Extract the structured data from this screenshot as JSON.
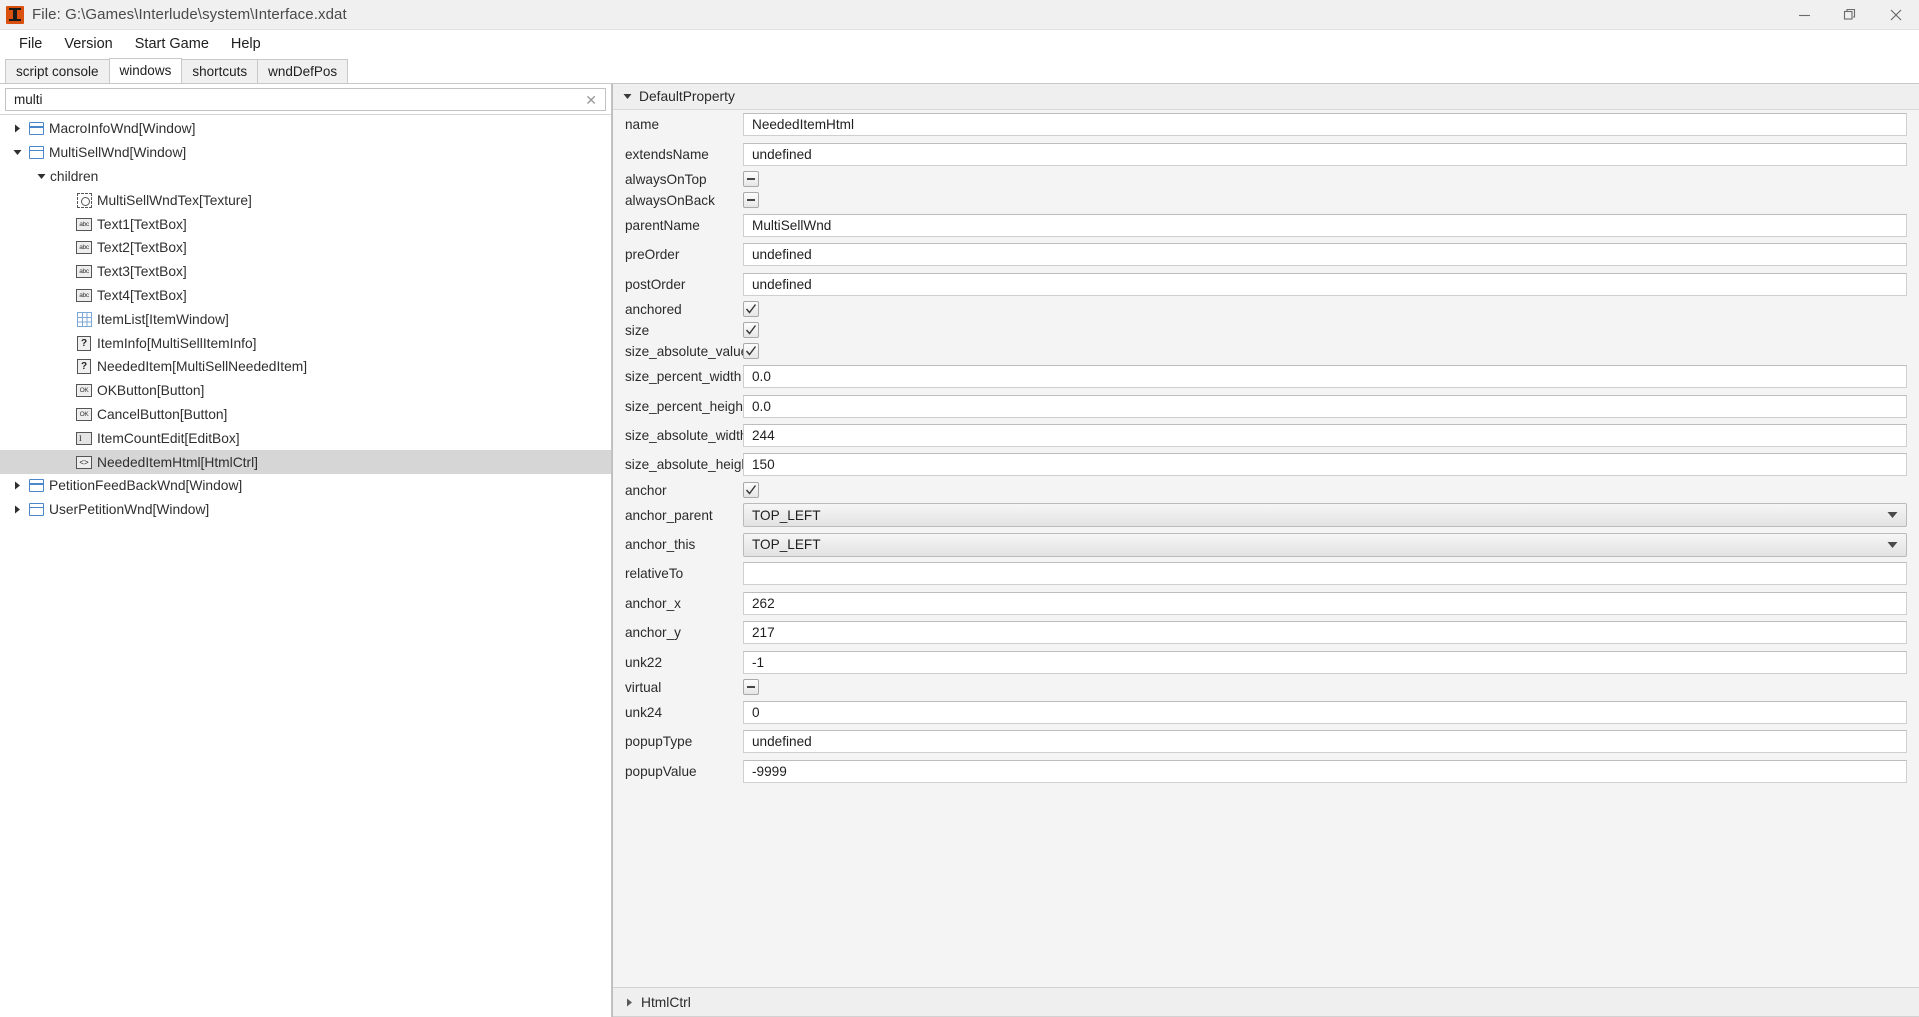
{
  "window": {
    "title": "File: G:\\Games\\Interlude\\system\\Interface.xdat",
    "app_icon": "lineage-app-icon",
    "controls": {
      "minimize": "minimize-icon",
      "restore": "restore-icon",
      "close": "close-icon"
    }
  },
  "menu": {
    "items": [
      {
        "label": "File"
      },
      {
        "label": "Version"
      },
      {
        "label": "Start Game"
      },
      {
        "label": "Help"
      }
    ]
  },
  "tabs": [
    {
      "label": "script console",
      "active": false
    },
    {
      "label": "windows",
      "active": true
    },
    {
      "label": "shortcuts",
      "active": false
    },
    {
      "label": "wndDefPos",
      "active": false
    }
  ],
  "search": {
    "value": "multi",
    "placeholder": "",
    "clear_icon": "clear-x-icon"
  },
  "tree": {
    "items": [
      {
        "label": "MacroInfoWnd[Window]",
        "indent": 0,
        "twisty": "collapsed",
        "icon": "window-icon",
        "selected": false
      },
      {
        "label": "MultiSellWnd[Window]",
        "indent": 0,
        "twisty": "expanded",
        "icon": "window-icon",
        "selected": false
      },
      {
        "label": "children",
        "indent": 1,
        "twisty": "expanded",
        "icon": "none",
        "selected": false
      },
      {
        "label": "MultiSellWndTex[Texture]",
        "indent": 2,
        "twisty": "none",
        "icon": "texture-icon",
        "selected": false
      },
      {
        "label": "Text1[TextBox]",
        "indent": 2,
        "twisty": "none",
        "icon": "textbox-icon",
        "selected": false
      },
      {
        "label": "Text2[TextBox]",
        "indent": 2,
        "twisty": "none",
        "icon": "textbox-icon",
        "selected": false
      },
      {
        "label": "Text3[TextBox]",
        "indent": 2,
        "twisty": "none",
        "icon": "textbox-icon",
        "selected": false
      },
      {
        "label": "Text4[TextBox]",
        "indent": 2,
        "twisty": "none",
        "icon": "textbox-icon",
        "selected": false
      },
      {
        "label": "ItemList[ItemWindow]",
        "indent": 2,
        "twisty": "none",
        "icon": "grid-icon",
        "selected": false
      },
      {
        "label": "ItemInfo[MultiSellItemInfo]",
        "indent": 2,
        "twisty": "none",
        "icon": "unknown-icon",
        "selected": false
      },
      {
        "label": "NeededItem[MultiSellNeededItem]",
        "indent": 2,
        "twisty": "none",
        "icon": "unknown-icon",
        "selected": false
      },
      {
        "label": "OKButton[Button]",
        "indent": 2,
        "twisty": "none",
        "icon": "button-icon",
        "selected": false
      },
      {
        "label": "CancelButton[Button]",
        "indent": 2,
        "twisty": "none",
        "icon": "button-icon",
        "selected": false
      },
      {
        "label": "ItemCountEdit[EditBox]",
        "indent": 2,
        "twisty": "none",
        "icon": "editbox-icon",
        "selected": false
      },
      {
        "label": "NeededItemHtml[HtmlCtrl]",
        "indent": 2,
        "twisty": "none",
        "icon": "htmlctrl-icon",
        "selected": true
      },
      {
        "label": "PetitionFeedBackWnd[Window]",
        "indent": 0,
        "twisty": "collapsed",
        "icon": "window-icon",
        "selected": false
      },
      {
        "label": "UserPetitionWnd[Window]",
        "indent": 0,
        "twisty": "collapsed",
        "icon": "window-icon",
        "selected": false
      }
    ]
  },
  "properties": {
    "group_title": "DefaultProperty",
    "group_twisty": "expanded",
    "rows": [
      {
        "label": "name",
        "type": "text",
        "value": "NeededItemHtml"
      },
      {
        "label": "extendsName",
        "type": "text",
        "value": "undefined"
      },
      {
        "label": "alwaysOnTop",
        "type": "checkbox",
        "state": "indeterminate"
      },
      {
        "label": "alwaysOnBack",
        "type": "checkbox",
        "state": "indeterminate"
      },
      {
        "label": "parentName",
        "type": "text",
        "value": "MultiSellWnd"
      },
      {
        "label": "preOrder",
        "type": "text",
        "value": "undefined"
      },
      {
        "label": "postOrder",
        "type": "text",
        "value": "undefined"
      },
      {
        "label": "anchored",
        "type": "checkbox",
        "state": "checked"
      },
      {
        "label": "size",
        "type": "checkbox",
        "state": "checked"
      },
      {
        "label": "size_absolute_values",
        "type": "checkbox",
        "state": "checked"
      },
      {
        "label": "size_percent_width",
        "type": "text",
        "value": "0.0"
      },
      {
        "label": "size_percent_height",
        "type": "text",
        "value": "0.0"
      },
      {
        "label": "size_absolute_width",
        "type": "text",
        "value": "244"
      },
      {
        "label": "size_absolute_height",
        "type": "text",
        "value": "150"
      },
      {
        "label": "anchor",
        "type": "checkbox",
        "state": "checked"
      },
      {
        "label": "anchor_parent",
        "type": "combo",
        "value": "TOP_LEFT"
      },
      {
        "label": "anchor_this",
        "type": "combo",
        "value": "TOP_LEFT"
      },
      {
        "label": "relativeTo",
        "type": "text",
        "value": ""
      },
      {
        "label": "anchor_x",
        "type": "text",
        "value": "262"
      },
      {
        "label": "anchor_y",
        "type": "text",
        "value": "217"
      },
      {
        "label": "unk22",
        "type": "text",
        "value": "-1"
      },
      {
        "label": "virtual",
        "type": "checkbox",
        "state": "indeterminate"
      },
      {
        "label": "unk24",
        "type": "text",
        "value": "0"
      },
      {
        "label": "popupType",
        "type": "text",
        "value": "undefined"
      },
      {
        "label": "popupValue",
        "type": "text",
        "value": "-9999"
      }
    ]
  },
  "bottom_group": {
    "title": "HtmlCtrl",
    "twisty": "collapsed"
  }
}
